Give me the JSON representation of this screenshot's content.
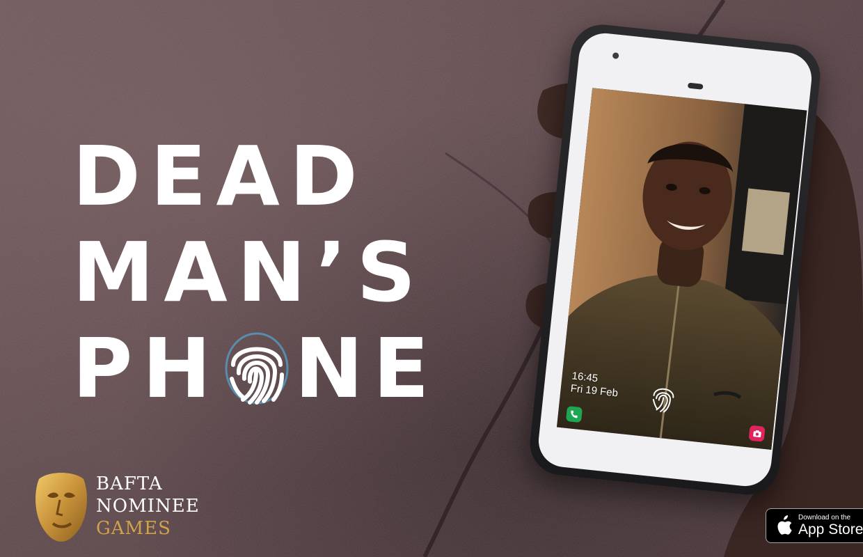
{
  "title": {
    "line1": "DEAD",
    "line2": "MAN’S",
    "line3_pre": "PH",
    "line3_post": "NE"
  },
  "bafta": {
    "line1": "BAFTA",
    "line2": "NOMINEE",
    "line3": "GAMES"
  },
  "phone": {
    "lock_time": "16:45",
    "lock_date": "Fri 19 Feb"
  },
  "app_store": {
    "small_label": "Download on the",
    "big_label": "App Store"
  },
  "icons": {
    "title_o": "fingerprint-icon",
    "lock_screen": "fingerprint-icon",
    "call": "phone-icon",
    "camera": "camera-icon",
    "store": "apple-icon",
    "award": "bafta-mask-icon"
  },
  "colors": {
    "background": "#5a4347",
    "title": "#ffffff",
    "bafta_gold": "#d0a24a",
    "call_green": "#1fa654",
    "camera_pink": "#e0245e",
    "fingerprint_blue": "#4fb7e8"
  }
}
